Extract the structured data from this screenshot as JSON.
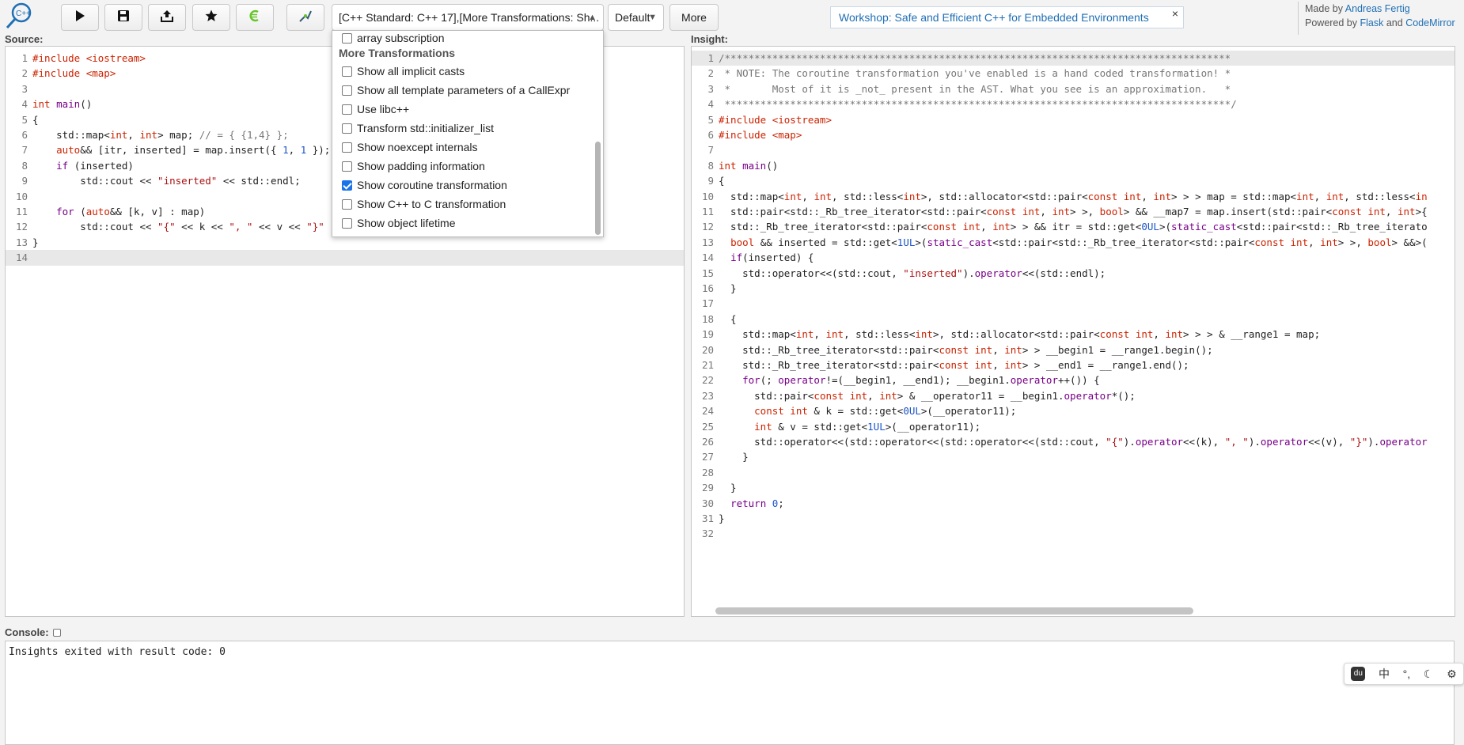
{
  "toolbar": {
    "select_standard": "[C++ Standard: C++ 17],[More Transformations: Sh...",
    "select_default": "Default",
    "more_label": "More",
    "workshop_label": "Workshop: Safe and Efficient C++ for Embedded Environments",
    "workshop_close": "×",
    "made_by_prefix": "Made by",
    "made_by_author": "Andreas Fertig",
    "powered_prefix": "Powered by",
    "powered_flask": "Flask",
    "powered_and": "and",
    "powered_codemirror": "CodeMirror"
  },
  "source": {
    "label": "Source:",
    "line_numbers": [
      "1",
      "2",
      "3",
      "4",
      "5",
      "6",
      "7",
      "8",
      "9",
      "10",
      "11",
      "12",
      "13",
      "14"
    ]
  },
  "insight": {
    "label": "Insight:",
    "line_numbers": [
      "1",
      "2",
      "3",
      "4",
      "5",
      "6",
      "7",
      "8",
      "9",
      "10",
      "11",
      "12",
      "13",
      "14",
      "15",
      "16",
      "17",
      "18",
      "19",
      "20",
      "21",
      "22",
      "23",
      "24",
      "25",
      "26",
      "27",
      "28",
      "29",
      "30",
      "31",
      "32"
    ]
  },
  "dropdown": {
    "top_item": "array subscription",
    "header": "More Transformations",
    "items": [
      {
        "label": "Show all implicit casts",
        "checked": false
      },
      {
        "label": "Show all template parameters of a CallExpr",
        "checked": false
      },
      {
        "label": "Use libc++",
        "checked": false
      },
      {
        "label": "Transform std::initializer_list",
        "checked": false
      },
      {
        "label": "Show noexcept internals",
        "checked": false
      },
      {
        "label": "Show padding information",
        "checked": false
      },
      {
        "label": "Show coroutine transformation",
        "checked": true
      },
      {
        "label": "Show C++ to C transformation",
        "checked": false
      },
      {
        "label": "Show object lifetime",
        "checked": false
      }
    ]
  },
  "console": {
    "label": "Console:",
    "output": "Insights exited with result code: 0"
  },
  "ime": {
    "lang": "中",
    "punct": "°,"
  }
}
